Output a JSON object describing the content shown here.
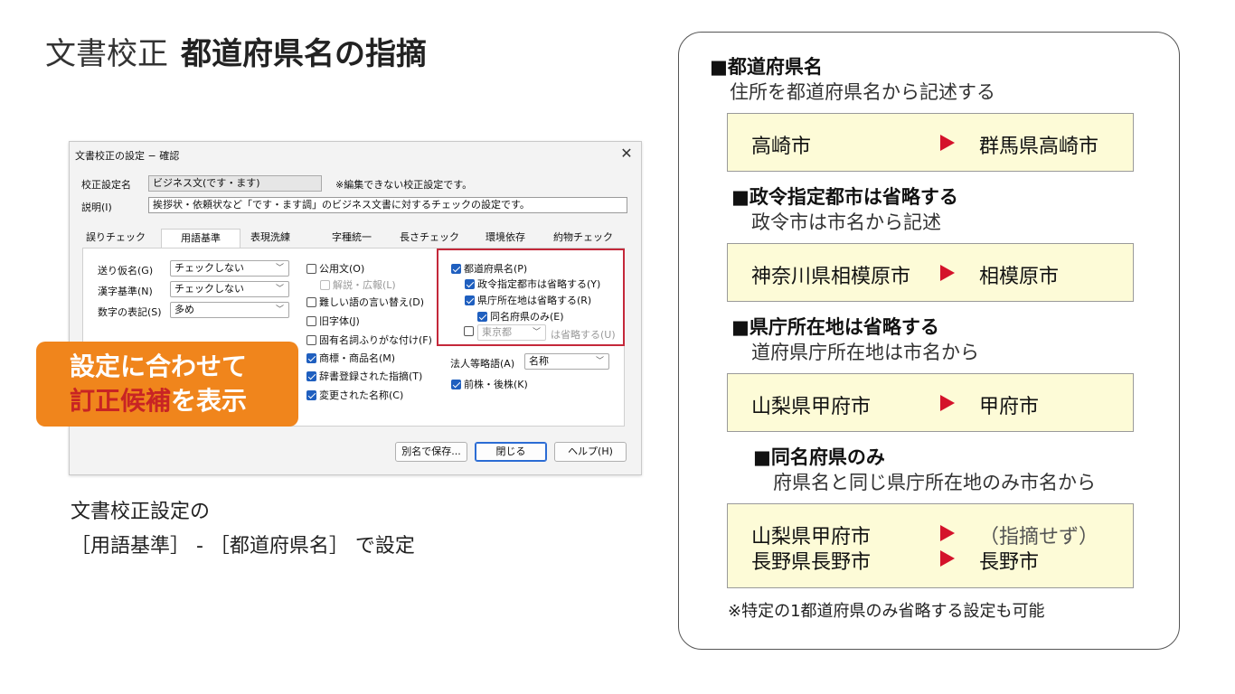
{
  "slide": {
    "title_light": "文書校正",
    "title_bold": "都道府県名の指摘"
  },
  "dialog": {
    "title": "文書校正の設定 − 確認",
    "close_glyph": "✕",
    "profile_label": "校正設定名",
    "profile_value": "ビジネス文(です・ます)",
    "profile_note": "※編集できない校正設定です。",
    "desc_label": "説明(I)",
    "desc_value": "挨拶状・依頼状など「です・ます調」のビジネス文書に対するチェックの設定です。",
    "tabs": [
      "誤りチェック",
      "用語基準",
      "表現洗練",
      "字種統一",
      "長さチェック",
      "環境依存",
      "約物チェック"
    ],
    "left_fields": [
      {
        "label": "送り仮名(G)",
        "value": "チェックしない"
      },
      {
        "label": "漢字基準(N)",
        "value": "チェックしない"
      },
      {
        "label": "数字の表記(S)",
        "value": "多め"
      }
    ],
    "middle_checks": [
      {
        "label": "公用文(O)",
        "checked": false
      },
      {
        "label": "解説・広報(L)",
        "checked": false,
        "disabled": true
      },
      {
        "label": "難しい語の言い替え(D)",
        "checked": false
      },
      {
        "label": "旧字体(J)",
        "checked": false
      },
      {
        "label": "固有名詞ふりがな付け(F)",
        "checked": false
      },
      {
        "label": "商標・商品名(M)",
        "checked": true
      },
      {
        "label": "辞書登録された指摘(T)",
        "checked": true
      },
      {
        "label": "変更された名称(C)",
        "checked": true
      }
    ],
    "pref_checks": [
      {
        "label": "都道府県名(P)",
        "checked": true
      },
      {
        "label": "政令指定都市は省略する(Y)",
        "checked": true
      },
      {
        "label": "県庁所在地は省略する(R)",
        "checked": true
      },
      {
        "label": "同名府県のみ(E)",
        "checked": true
      }
    ],
    "tokyo_select": "東京都",
    "tokyo_suffix": "は省略する(U)",
    "corp_label": "法人等略語(A)",
    "corp_value": "名称",
    "maekabu_label": "前株・後株(K)",
    "buttons": {
      "save_as": "別名で保存...",
      "close": "閉じる",
      "help": "ヘルプ(H)"
    }
  },
  "callout": {
    "line1": "設定に合わせて",
    "line2_red": "訂正候補",
    "line2_rest": "を表示"
  },
  "caption": {
    "line1": "文書校正設定の",
    "line2": "［用語基準］ - ［都道府県名］ で設定"
  },
  "panel": {
    "sections": [
      {
        "head": "■都道府県名",
        "sub": "住所を都道府県名から記述する",
        "examples": [
          {
            "from": "高崎市",
            "to": "群馬県高崎市"
          }
        ]
      },
      {
        "head": "■政令指定都市は省略する",
        "sub": "政令市は市名から記述",
        "examples": [
          {
            "from": "神奈川県相模原市",
            "to": "相模原市"
          }
        ]
      },
      {
        "head": "■県庁所在地は省略する",
        "sub": "道府県庁所在地は市名から",
        "examples": [
          {
            "from": "山梨県甲府市",
            "to": "甲府市"
          }
        ]
      },
      {
        "head": "■同名府県のみ",
        "sub": "府県名と同じ県庁所在地のみ市名から",
        "examples": [
          {
            "from": "山梨県甲府市",
            "to": "（指摘せず）"
          },
          {
            "from": "長野県長野市",
            "to": "長野市"
          }
        ]
      }
    ],
    "footnote": "※特定の1都道府県のみ省略する設定も可能"
  },
  "colors": {
    "arrow": "#d4122a",
    "callout": "#f0851c",
    "frame": "#c4283a",
    "example_bg": "#fdfbd7"
  }
}
